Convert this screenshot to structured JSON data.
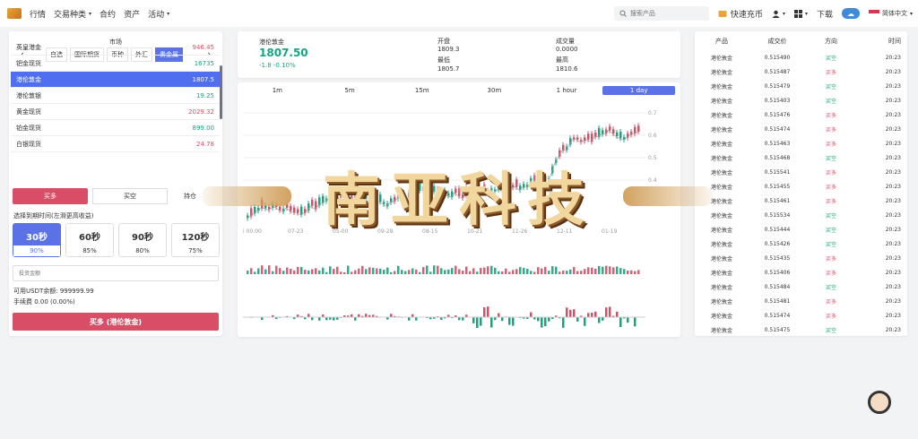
{
  "nav": {
    "items": [
      {
        "label": "行情",
        "caret": false
      },
      {
        "label": "交易种类",
        "caret": true
      },
      {
        "label": "合约",
        "caret": false
      },
      {
        "label": "资产",
        "caret": false
      },
      {
        "label": "活动",
        "caret": true
      }
    ],
    "search_placeholder": "搜索产品",
    "quick_topup": "快速充币",
    "download": "下载",
    "language": "简体中文"
  },
  "market": {
    "title": "市场",
    "tabs": [
      "自选",
      "国际期货",
      "币种",
      "外汇",
      "贵金属"
    ],
    "active_tab": 4,
    "rows": [
      {
        "name": "英皇港金",
        "price": "946.45",
        "dir": "red"
      },
      {
        "name": "钯金现货",
        "price": "16735",
        "dir": "green"
      },
      {
        "name": "港伦敦金",
        "price": "1807.5",
        "dir": "active"
      },
      {
        "name": "港伦敦银",
        "price": "19.25",
        "dir": "green"
      },
      {
        "name": "黄金现货",
        "price": "2029.32",
        "dir": "red"
      },
      {
        "name": "铂金现货",
        "price": "899.00",
        "dir": "green"
      },
      {
        "name": "白银现货",
        "price": "24.78",
        "dir": "red"
      }
    ]
  },
  "order": {
    "buy_label": "买多",
    "sell_label": "买空",
    "third_label": "持仓",
    "period_hint": "选择到期时间(左滑更高收益)",
    "periods": [
      {
        "time": "30秒",
        "rate": "90%",
        "active": true
      },
      {
        "time": "60秒",
        "rate": "85%",
        "active": false
      },
      {
        "time": "90秒",
        "rate": "80%",
        "active": false
      },
      {
        "time": "120秒",
        "rate": "75%",
        "active": false
      }
    ],
    "amount_placeholder": "投资金额",
    "balance": "可用USDT余额: 999999.99",
    "fee": "手续费 0.00 (0.00%)",
    "submit": "买多 (港伦敦金)"
  },
  "quote": {
    "name": "港伦敦金",
    "price": "1807.50",
    "change": "-1.8 -0.10%",
    "open_label": "开盘",
    "open": "1809.3",
    "low_label": "最低",
    "low": "1805.7",
    "volume_label": "成交量",
    "volume": "0.0000",
    "high_label": "最高",
    "high": "1810.6"
  },
  "chart": {
    "intervals": [
      "1m",
      "5m",
      "15m",
      "30m",
      "1 hour",
      "1 day"
    ],
    "active_interval": 5,
    "y_ticks": [
      "0.7",
      "0.6",
      "0.5",
      "0.4"
    ],
    "x_ticks": [
      "i 00:00",
      "07-23",
      "05-00",
      "09-28",
      "08-15",
      "10-21",
      "11-26",
      "12-11",
      "01-19"
    ],
    "colors": {
      "up": "#13a584",
      "down": "#d84e67"
    }
  },
  "trades": {
    "headers": [
      "产品",
      "成交价",
      "方向",
      "时间"
    ],
    "rows": [
      {
        "p": "港伦敦金",
        "price": "0.515490",
        "dir": "买空",
        "t": "20:23"
      },
      {
        "p": "港伦敦金",
        "price": "0.515487",
        "dir": "买多",
        "t": "20:23"
      },
      {
        "p": "港伦敦金",
        "price": "0.515479",
        "dir": "买空",
        "t": "20:23"
      },
      {
        "p": "港伦敦金",
        "price": "0.515403",
        "dir": "买空",
        "t": "20:23"
      },
      {
        "p": "港伦敦金",
        "price": "0.515476",
        "dir": "买多",
        "t": "20:23"
      },
      {
        "p": "港伦敦金",
        "price": "0.515474",
        "dir": "买多",
        "t": "20:23"
      },
      {
        "p": "港伦敦金",
        "price": "0.515463",
        "dir": "买多",
        "t": "20:23"
      },
      {
        "p": "港伦敦金",
        "price": "0.515468",
        "dir": "买空",
        "t": "20:23"
      },
      {
        "p": "港伦敦金",
        "price": "0.515541",
        "dir": "买多",
        "t": "20:23"
      },
      {
        "p": "港伦敦金",
        "price": "0.515455",
        "dir": "买多",
        "t": "20:23"
      },
      {
        "p": "港伦敦金",
        "price": "0.515461",
        "dir": "买多",
        "t": "20:23"
      },
      {
        "p": "港伦敦金",
        "price": "0.515534",
        "dir": "买空",
        "t": "20:23"
      },
      {
        "p": "港伦敦金",
        "price": "0.515444",
        "dir": "买空",
        "t": "20:23"
      },
      {
        "p": "港伦敦金",
        "price": "0.515426",
        "dir": "买空",
        "t": "20:23"
      },
      {
        "p": "港伦敦金",
        "price": "0.515435",
        "dir": "买多",
        "t": "20:23"
      },
      {
        "p": "港伦敦金",
        "price": "0.515406",
        "dir": "买多",
        "t": "20:23"
      },
      {
        "p": "港伦敦金",
        "price": "0.515484",
        "dir": "买空",
        "t": "20:23"
      },
      {
        "p": "港伦敦金",
        "price": "0.515481",
        "dir": "买多",
        "t": "20:23"
      },
      {
        "p": "港伦敦金",
        "price": "0.515474",
        "dir": "买多",
        "t": "20:23"
      },
      {
        "p": "港伦敦金",
        "price": "0.515475",
        "dir": "买空",
        "t": "20:23"
      }
    ]
  },
  "watermark": "南亚科技"
}
